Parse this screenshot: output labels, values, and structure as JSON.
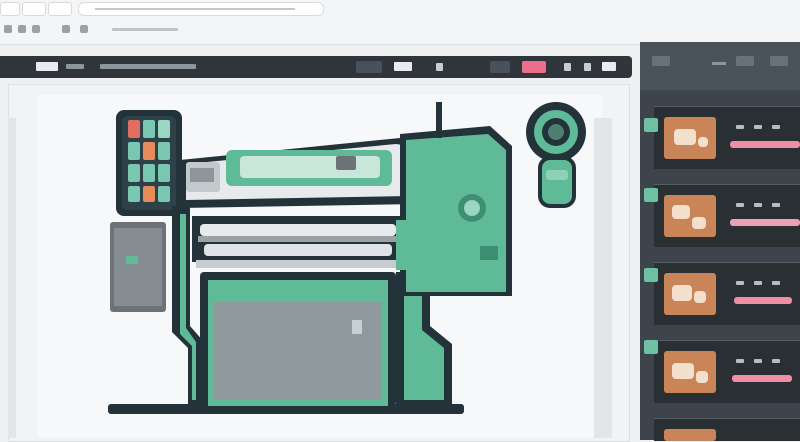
{
  "browser": {
    "tabs": [
      "",
      "",
      ""
    ],
    "url": ""
  },
  "toolbar": {
    "title": "",
    "actions": [
      "",
      "",
      "",
      ""
    ]
  },
  "side_panel": {
    "items": [
      {
        "thumb": "print-thumbnail"
      },
      {
        "thumb": "print-thumbnail"
      },
      {
        "thumb": "print-thumbnail"
      },
      {
        "thumb": "print-thumbnail"
      }
    ]
  },
  "colors": {
    "machine_green": "#5fba98",
    "machine_dark": "#24323a",
    "accent_pink": "#e96f8a",
    "panel_dark": "#3d444b",
    "thumb_orange": "#c98558"
  },
  "icons": [
    "printer-machine-illustration",
    "webcam-icon"
  ]
}
